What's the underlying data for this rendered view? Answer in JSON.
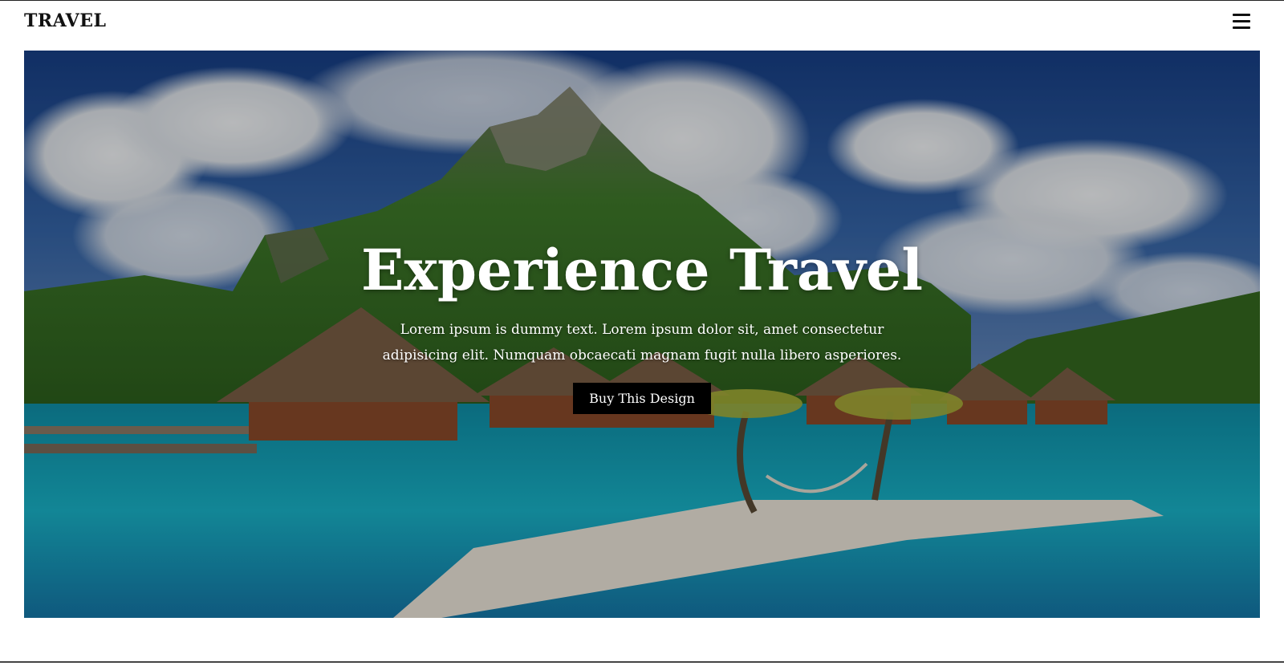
{
  "header": {
    "brand": "TRAVEL",
    "menu_icon": "hamburger-menu-icon"
  },
  "hero": {
    "title": "Experience Travel",
    "description": "Lorem ipsum is dummy text. Lorem ipsum dolor sit, amet consectetur adipisicing elit. Numquam obcaecati magnam fugit nulla libero asperiores.",
    "button_label": "Buy This Design",
    "image": "tropical-island-resort-image"
  },
  "colors": {
    "button_bg": "#000000",
    "text_on_hero": "#ffffff",
    "brand_text": "#111111"
  }
}
